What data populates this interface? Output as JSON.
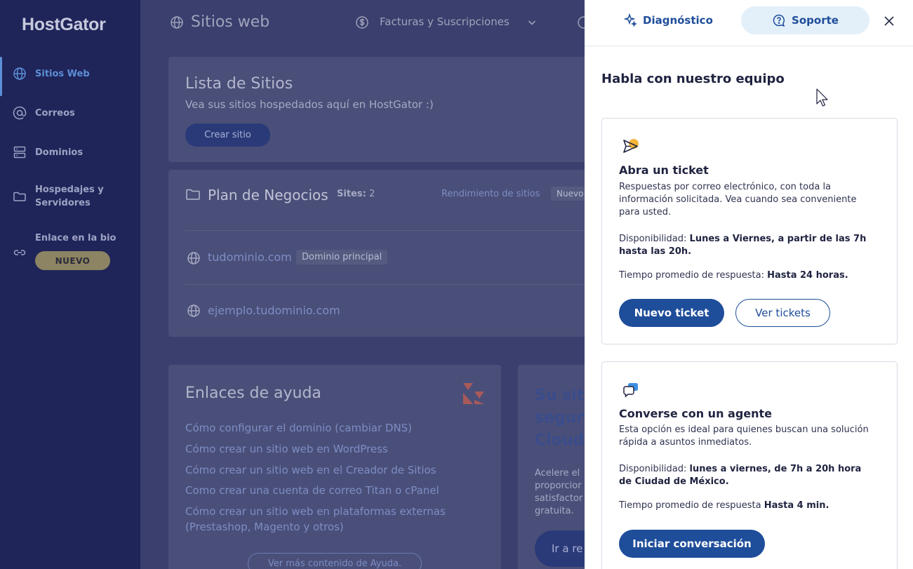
{
  "app": {
    "logo": "HostGator"
  },
  "sidebar": {
    "items": [
      {
        "label": "Sitios Web",
        "icon": "globe-icon",
        "active": true
      },
      {
        "label": "Correos",
        "icon": "at-icon"
      },
      {
        "label": "Dominios",
        "icon": "server-icon"
      },
      {
        "label": "Hospedajes y Servidores",
        "icon": "folder-icon"
      },
      {
        "label": "Enlace en la bio",
        "icon": "link-icon",
        "badge": "NUEVO"
      }
    ]
  },
  "topbar": {
    "title": "Sitios web",
    "billing": "Facturas y Suscripciones"
  },
  "sites_card": {
    "title": "Lista de Sitios",
    "subtitle": "Vea sus sitios hospedados aquí en HostGator :)",
    "create_button": "Crear sitio"
  },
  "plan_card": {
    "plan_name": "Plan de Negocios",
    "sites_label": "Sites:",
    "sites_count": "2",
    "performance_link": "Rendimiento de sitios",
    "new_chip": "Nuevo",
    "domains": [
      {
        "name": "tudominio.com",
        "tag": "Dominio principal"
      },
      {
        "name": "ejemplo.tudominio.com"
      }
    ]
  },
  "help_card": {
    "title": "Enlaces de ayuda",
    "links": [
      "Cómo configurar el dominio (cambiar DNS)",
      "Cómo crear un sitio web en WordPress",
      "Cómo crear un sitio web en el Creador de Sitios",
      "Como crear una cuenta de correo Titan o cPanel",
      "Cómo crear un sitio web en plataformas externas",
      "(Prestashop, Magento y otros)"
    ],
    "more_button": "Ver más contenido de Ayuda."
  },
  "promo_card": {
    "title_lines": [
      "Su siti",
      "segur",
      "Cloud"
    ],
    "text_lines": [
      "Acelere el",
      "proporcior",
      "satisfactor",
      "gratuita."
    ],
    "button": "Ir a re"
  },
  "panel": {
    "tab_diagnostic": "Diagnóstico",
    "tab_support": "Soporte",
    "heading": "Habla con nuestro equipo",
    "ticket": {
      "title": "Abra un ticket",
      "description": "Respuestas por correo electrónico, con toda la información solicitada. Vea cuando sea conveniente para usted.",
      "availability_label": "Disponibilidad:",
      "availability_value": "Lunes a Viernes, a partir de las 7h hasta las 20h.",
      "response_label": "Tiempo promedio de respuesta:",
      "response_value": "Hasta 24 horas.",
      "new_button": "Nuevo ticket",
      "view_button": "Ver tickets"
    },
    "chat": {
      "title": "Converse con un agente",
      "description": "Esta opción es ideal para quienes buscan una solución rápida a asuntos inmediatos.",
      "availability_label": "Disponibilidad:",
      "availability_value": "lunes a viernes, de 7h a 20h hora de Ciudad de México.",
      "response_label": "Tiempo promedio de respuesta",
      "response_value": "Hasta 4 min.",
      "start_button": "Iniciar conversación"
    }
  },
  "colors": {
    "sidebar_bg": "#1f2459",
    "accent_blue": "#1e4d9a",
    "active_nav": "#5c8fd6",
    "badge_bg": "#8c8462",
    "support_tab_bg": "#e3f0fa"
  }
}
